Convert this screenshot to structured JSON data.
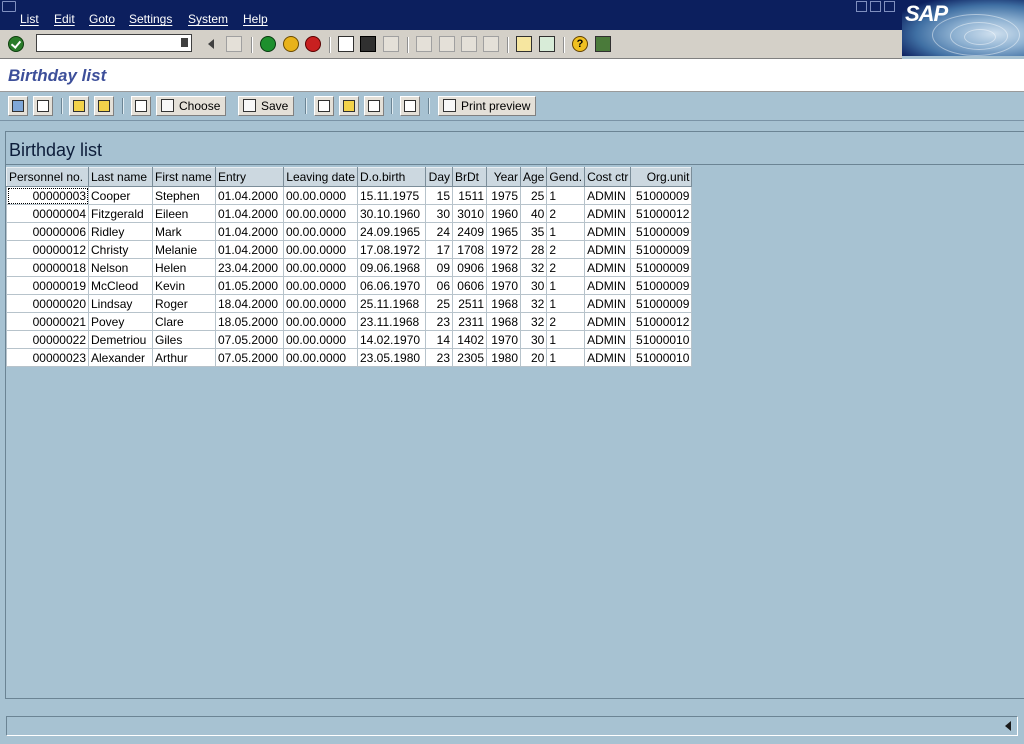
{
  "menu": {
    "items": [
      {
        "label": "List"
      },
      {
        "label": "Edit"
      },
      {
        "label": "Goto"
      },
      {
        "label": "Settings"
      },
      {
        "label": "System"
      },
      {
        "label": "Help"
      }
    ]
  },
  "brand": {
    "logo_text": "SAP"
  },
  "command_field": {
    "value": ""
  },
  "title": {
    "text": "Birthday list"
  },
  "app_toolbar": {
    "choose_label": "Choose",
    "save_label": "Save",
    "print_preview_label": "Print preview"
  },
  "list": {
    "title": "Birthday list",
    "columns": [
      "Personnel no.",
      "Last name",
      "First name",
      "Entry",
      "Leaving date",
      "D.o.birth",
      "Day",
      "BrDt",
      "Year",
      "Age",
      "Gend.",
      "Cost ctr",
      "Org.unit"
    ],
    "rows": [
      [
        "00000003",
        "Cooper",
        "Stephen",
        "01.04.2000",
        "00.00.0000",
        "15.11.1975",
        "15",
        "1511",
        "1975",
        "25",
        "1",
        "ADMIN",
        "51000009"
      ],
      [
        "00000004",
        "Fitzgerald",
        "Eileen",
        "01.04.2000",
        "00.00.0000",
        "30.10.1960",
        "30",
        "3010",
        "1960",
        "40",
        "2",
        "ADMIN",
        "51000012"
      ],
      [
        "00000006",
        "Ridley",
        "Mark",
        "01.04.2000",
        "00.00.0000",
        "24.09.1965",
        "24",
        "2409",
        "1965",
        "35",
        "1",
        "ADMIN",
        "51000009"
      ],
      [
        "00000012",
        "Christy",
        "Melanie",
        "01.04.2000",
        "00.00.0000",
        "17.08.1972",
        "17",
        "1708",
        "1972",
        "28",
        "2",
        "ADMIN",
        "51000009"
      ],
      [
        "00000018",
        "Nelson",
        "Helen",
        "23.04.2000",
        "00.00.0000",
        "09.06.1968",
        "09",
        "0906",
        "1968",
        "32",
        "2",
        "ADMIN",
        "51000009"
      ],
      [
        "00000019",
        "McCleod",
        "Kevin",
        "01.05.2000",
        "00.00.0000",
        "06.06.1970",
        "06",
        "0606",
        "1970",
        "30",
        "1",
        "ADMIN",
        "51000009"
      ],
      [
        "00000020",
        "Lindsay",
        "Roger",
        "18.04.2000",
        "00.00.0000",
        "25.11.1968",
        "25",
        "2511",
        "1968",
        "32",
        "1",
        "ADMIN",
        "51000009"
      ],
      [
        "00000021",
        "Povey",
        "Clare",
        "18.05.2000",
        "00.00.0000",
        "23.11.1968",
        "23",
        "2311",
        "1968",
        "32",
        "2",
        "ADMIN",
        "51000012"
      ],
      [
        "00000022",
        "Demetriou",
        "Giles",
        "07.05.2000",
        "00.00.0000",
        "14.02.1970",
        "14",
        "1402",
        "1970",
        "30",
        "1",
        "ADMIN",
        "51000010"
      ],
      [
        "00000023",
        "Alexander",
        "Arthur",
        "07.05.2000",
        "00.00.0000",
        "23.05.1980",
        "23",
        "2305",
        "1980",
        "20",
        "1",
        "ADMIN",
        "51000010"
      ]
    ]
  },
  "status": {
    "text": ""
  }
}
